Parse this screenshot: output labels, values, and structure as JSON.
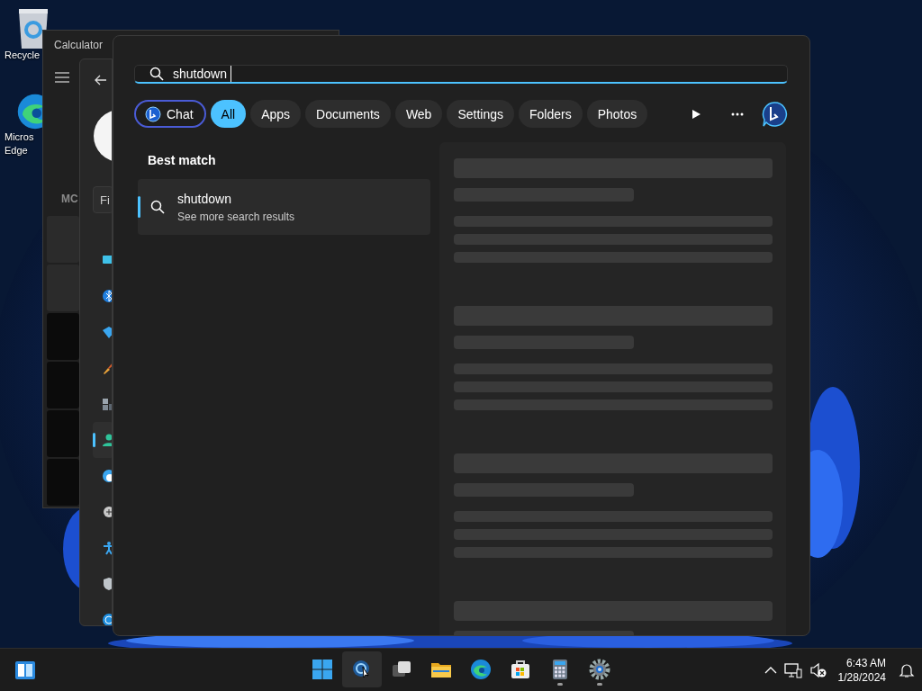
{
  "desktop_icons": [
    {
      "kind": "recycle-bin",
      "lines": [
        "Recycle"
      ]
    },
    {
      "kind": "edge",
      "lines": [
        "Micros",
        "Edge"
      ]
    }
  ],
  "calculator": {
    "title": "Calculator",
    "memory_label": "MC"
  },
  "settings_window": {
    "search_placeholder": "Fi",
    "nav_items": [
      {
        "kind": "monitor",
        "selected": false
      },
      {
        "kind": "bluetooth",
        "selected": false
      },
      {
        "kind": "wifi",
        "selected": false
      },
      {
        "kind": "brush",
        "selected": false
      },
      {
        "kind": "apps",
        "selected": false
      },
      {
        "kind": "person",
        "selected": true
      },
      {
        "kind": "clock",
        "selected": false
      },
      {
        "kind": "gamepad",
        "selected": false
      },
      {
        "kind": "accessibility",
        "selected": false
      },
      {
        "kind": "shield",
        "selected": false
      },
      {
        "kind": "sync",
        "selected": false
      }
    ]
  },
  "search": {
    "query": "shutdown",
    "filters": [
      {
        "kind": "chat",
        "label": "Chat",
        "selected": false
      },
      {
        "kind": "filter",
        "label": "All",
        "selected": true
      },
      {
        "kind": "filter",
        "label": "Apps",
        "selected": false
      },
      {
        "kind": "filter",
        "label": "Documents",
        "selected": false
      },
      {
        "kind": "filter",
        "label": "Web",
        "selected": false
      },
      {
        "kind": "filter",
        "label": "Settings",
        "selected": false
      },
      {
        "kind": "filter",
        "label": "Folders",
        "selected": false
      },
      {
        "kind": "filter",
        "label": "Photos",
        "selected": false
      }
    ],
    "best_match": {
      "heading": "Best match",
      "title": "shutdown",
      "subtitle": "See more search results",
      "selected": true
    }
  },
  "taskbar": {
    "apps": [
      {
        "kind": "start",
        "active": false,
        "running": false
      },
      {
        "kind": "search",
        "active": true,
        "running": false
      },
      {
        "kind": "taskview",
        "active": false,
        "running": false
      },
      {
        "kind": "explorer",
        "active": false,
        "running": false
      },
      {
        "kind": "edge",
        "active": false,
        "running": false
      },
      {
        "kind": "store",
        "active": false,
        "running": false
      },
      {
        "kind": "calculator",
        "active": false,
        "running": true
      },
      {
        "kind": "settings",
        "active": false,
        "running": true
      }
    ],
    "time": "6:43 AM",
    "date": "1/28/2024"
  }
}
